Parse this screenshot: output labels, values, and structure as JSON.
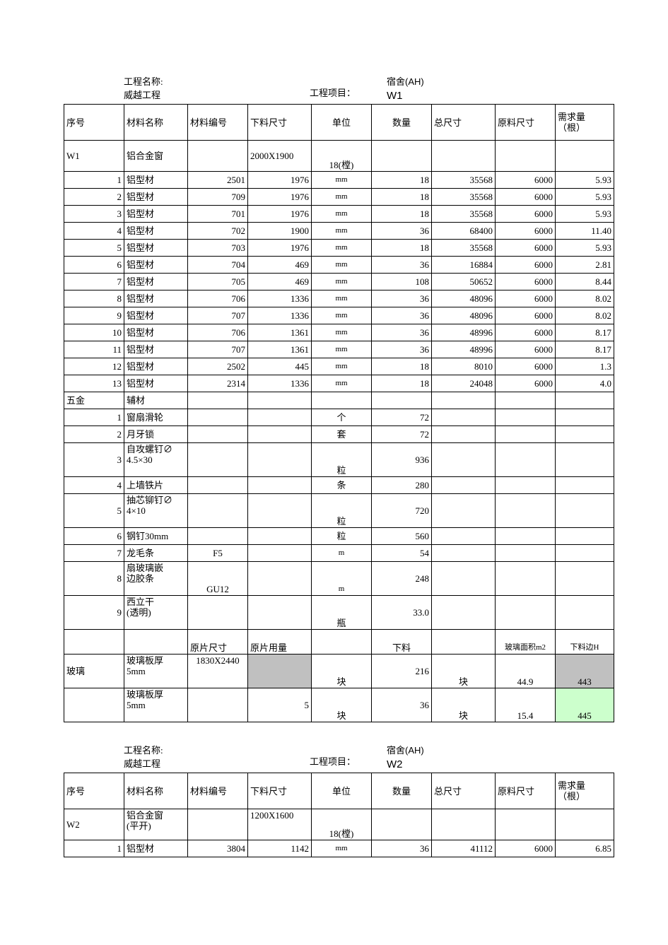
{
  "sheets": [
    {
      "id": "W1",
      "header": {
        "name_label": "工程名称:\n威越工程",
        "project_label": "工程项目：",
        "project_value_line1": "宿舍(AH)",
        "project_value_line2": "W1"
      },
      "columns": [
        "序号",
        "材料名称",
        "材料编号",
        "下料尺寸",
        "单位",
        "数量",
        "总尺寸",
        "原料尺寸",
        "需求量\n（根）"
      ],
      "rows": [
        {
          "type": "group",
          "cells": [
            "W1",
            "铝合金窗",
            "",
            "2000X1900",
            "18(樘)",
            "",
            "",
            "",
            ""
          ]
        },
        {
          "type": "data",
          "cells": [
            "1",
            "铝型材",
            "2501",
            "1976",
            "mm",
            "18",
            "35568",
            "6000",
            "5.93"
          ]
        },
        {
          "type": "data",
          "cells": [
            "2",
            "铝型材",
            "709",
            "1976",
            "mm",
            "18",
            "35568",
            "6000",
            "5.93"
          ]
        },
        {
          "type": "data",
          "cells": [
            "3",
            "铝型材",
            "701",
            "1976",
            "mm",
            "18",
            "35568",
            "6000",
            "5.93"
          ]
        },
        {
          "type": "data",
          "cells": [
            "4",
            "铝型材",
            "702",
            "1900",
            "mm",
            "36",
            "68400",
            "6000",
            "11.40"
          ]
        },
        {
          "type": "data",
          "cells": [
            "5",
            "铝型材",
            "703",
            "1976",
            "mm",
            "18",
            "35568",
            "6000",
            "5.93"
          ]
        },
        {
          "type": "data",
          "cells": [
            "6",
            "铝型材",
            "704",
            "469",
            "mm",
            "36",
            "16884",
            "6000",
            "2.81"
          ]
        },
        {
          "type": "data",
          "cells": [
            "7",
            "铝型材",
            "705",
            "469",
            "mm",
            "108",
            "50652",
            "6000",
            "8.44"
          ]
        },
        {
          "type": "data",
          "cells": [
            "8",
            "铝型材",
            "706",
            "1336",
            "mm",
            "36",
            "48096",
            "6000",
            "8.02"
          ]
        },
        {
          "type": "data",
          "cells": [
            "9",
            "铝型材",
            "707",
            "1336",
            "mm",
            "36",
            "48096",
            "6000",
            "8.02"
          ]
        },
        {
          "type": "data",
          "cells": [
            "10",
            "铝型材",
            "706",
            "1361",
            "mm",
            "36",
            "48996",
            "6000",
            "8.17"
          ]
        },
        {
          "type": "data",
          "cells": [
            "11",
            "铝型材",
            "707",
            "1361",
            "mm",
            "36",
            "48996",
            "6000",
            "8.17"
          ]
        },
        {
          "type": "data",
          "cells": [
            "12",
            "铝型材",
            "2502",
            "445",
            "mm",
            "18",
            "8010",
            "6000",
            "1.3"
          ]
        },
        {
          "type": "data",
          "cells": [
            "13",
            "铝型材",
            "2314",
            "1336",
            "mm",
            "18",
            "24048",
            "6000",
            "4.0"
          ]
        },
        {
          "type": "group2",
          "cells": [
            "五金",
            "辅材",
            "",
            "",
            "",
            "",
            "",
            "",
            ""
          ]
        },
        {
          "type": "data",
          "cells": [
            "1",
            "窗扇滑轮",
            "",
            "",
            "个",
            "72",
            "",
            "",
            ""
          ]
        },
        {
          "type": "data",
          "cells": [
            "2",
            "月牙锁",
            "",
            "",
            "套",
            "72",
            "",
            "",
            ""
          ]
        },
        {
          "type": "data2",
          "cells": [
            "3",
            "自攻螺钉∅\n4.5×30",
            "",
            "",
            "粒",
            "936",
            "",
            "",
            ""
          ]
        },
        {
          "type": "data",
          "cells": [
            "4",
            "上墙铁片",
            "",
            "",
            "条",
            "280",
            "",
            "",
            ""
          ]
        },
        {
          "type": "data2",
          "cells": [
            "5",
            "抽芯铆钉∅\n4×10",
            "",
            "",
            "粒",
            "720",
            "",
            "",
            ""
          ]
        },
        {
          "type": "data",
          "cells": [
            "6",
            "钢钉30mm",
            "",
            "",
            "粒",
            "560",
            "",
            "",
            ""
          ]
        },
        {
          "type": "data",
          "cells": [
            "7",
            "龙毛条",
            "F5",
            "",
            "m",
            "54",
            "",
            "",
            ""
          ]
        },
        {
          "type": "data2",
          "cells": [
            "8",
            "扇玻璃嵌\n边胶条",
            "GU12",
            "",
            "m",
            "248",
            "",
            "",
            ""
          ]
        },
        {
          "type": "data2",
          "cells": [
            "9",
            "西立干\n(透明)",
            "",
            "",
            "瓶",
            "33.0",
            "",
            "",
            ""
          ]
        },
        {
          "type": "subhdr",
          "cells": [
            "",
            "",
            "原片尺寸",
            "原片用量",
            "",
            "下料",
            "",
            "玻璃面积m2",
            "下料边H"
          ]
        },
        {
          "type": "glass",
          "cells": [
            "玻璃",
            "玻璃板厚\n5mm",
            "1830X2440",
            "",
            "块",
            "216",
            "块",
            "44.9",
            "443"
          ]
        },
        {
          "type": "glass",
          "cells": [
            "",
            "玻璃板厚\n5mm",
            "",
            "5",
            "块",
            "36",
            "块",
            "15.4",
            "445"
          ]
        }
      ]
    },
    {
      "id": "W2",
      "header": {
        "name_label": "工程名称:\n威越工程",
        "project_label": "工程项目：",
        "project_value_line1": "宿舍(AH)",
        "project_value_line2": "W2"
      },
      "columns": [
        "序号",
        "材料名称",
        "材料编号",
        "下料尺寸",
        "单位",
        "数量",
        "总尺寸",
        "原料尺寸",
        "需求量\n（根）"
      ],
      "rows": [
        {
          "type": "group",
          "cells": [
            "W2",
            "铝合金窗\n(平开)",
            "",
            "1200X1600",
            "18(樘)",
            "",
            "",
            "",
            ""
          ]
        },
        {
          "type": "data",
          "cells": [
            "1",
            "铝型材",
            "3804",
            "1142",
            "mm",
            "36",
            "41112",
            "6000",
            "6.85"
          ]
        }
      ]
    }
  ],
  "colors": {
    "highlight_gray": "#c0c0c0",
    "highlight_green": "#ccffcc",
    "grid_line": "#000000",
    "background": "#ffffff"
  }
}
